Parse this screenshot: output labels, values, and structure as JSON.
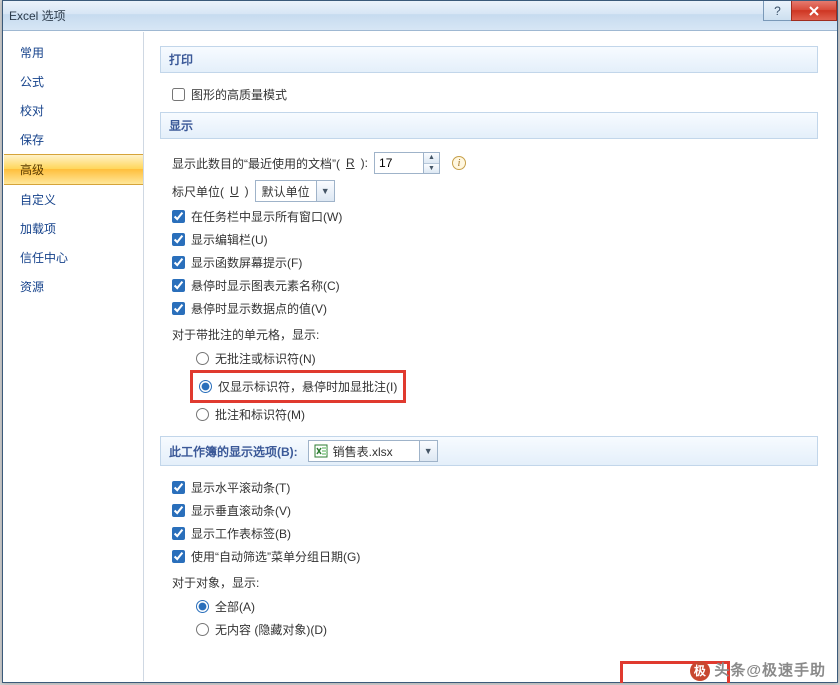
{
  "window": {
    "title": "Excel 选项"
  },
  "sidebar": {
    "items": [
      {
        "label": "常用"
      },
      {
        "label": "公式"
      },
      {
        "label": "校对"
      },
      {
        "label": "保存"
      },
      {
        "label": "高级",
        "active": true
      },
      {
        "label": "自定义"
      },
      {
        "label": "加载项"
      },
      {
        "label": "信任中心"
      },
      {
        "label": "资源"
      }
    ]
  },
  "sections": {
    "print": {
      "header": "打印",
      "high_quality_graphics": "图形的高质量模式"
    },
    "display": {
      "header": "显示",
      "recent_docs_label_pre": "显示此数目的“最近使用的文档”(",
      "recent_docs_key": "R",
      "recent_docs_label_post": "):",
      "recent_docs_value": "17",
      "ruler_units_label_pre": "标尺单位(",
      "ruler_units_key": "U",
      "ruler_units_label_post": ")",
      "ruler_units_value": "默认单位",
      "show_all_windows_taskbar": "在任务栏中显示所有窗口(W)",
      "show_formula_bar": "显示编辑栏(U)",
      "show_function_tooltips": "显示函数屏幕提示(F)",
      "hover_show_chart_names": "悬停时显示图表元素名称(C)",
      "hover_show_datapoint_values": "悬停时显示数据点的值(V)",
      "comments_group_label": "对于带批注的单元格，显示:",
      "comment_none": "无批注或标识符(N)",
      "comment_indicator_only": "仅显示标识符，悬停时加显批注(I)",
      "comment_and_indicator": "批注和标识符(M)"
    },
    "workbook_display": {
      "header_pre": "此工作簿的显示选项(",
      "header_key": "B",
      "header_post": "):",
      "selected_workbook": "销售表.xlsx",
      "show_horizontal_scrollbar": "显示水平滚动条(T)",
      "show_vertical_scrollbar": "显示垂直滚动条(V)",
      "show_sheet_tabs": "显示工作表标签(B)",
      "autofilter_group_dates": "使用“自动筛选”菜单分组日期(G)",
      "objects_group_label": "对于对象，显示:",
      "objects_all": "全部(A)",
      "objects_none": "无内容 (隐藏对象)(D)"
    }
  },
  "watermark": "头条@极速手助"
}
